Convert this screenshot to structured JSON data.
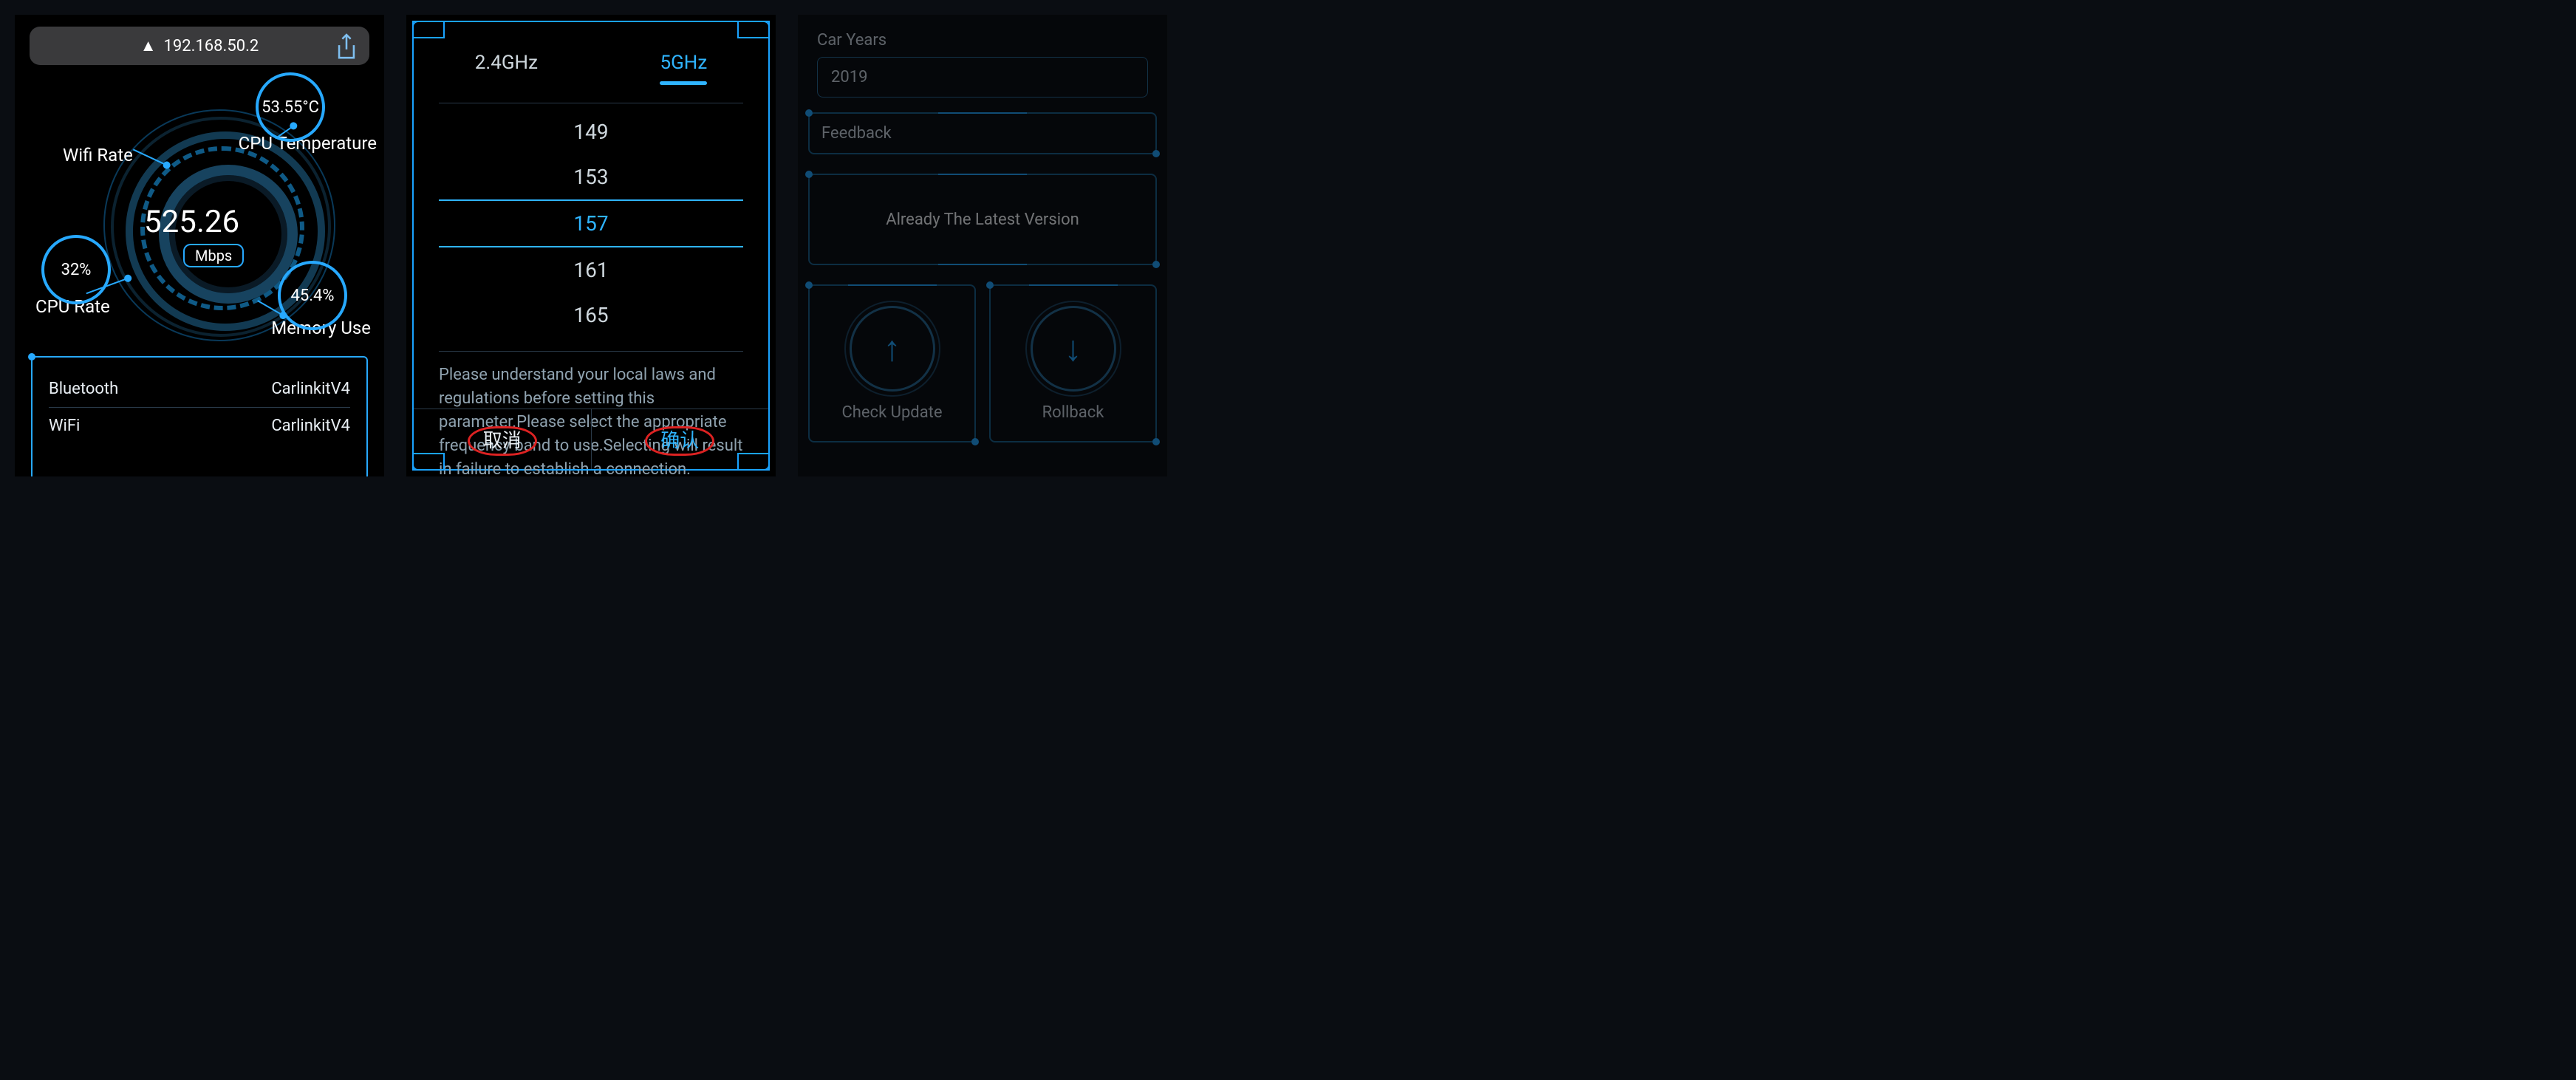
{
  "panel1": {
    "address": "192.168.50.2",
    "wifi_rate_label": "Wifi Rate",
    "wifi_rate_value": "525.26",
    "wifi_rate_unit": "Mbps",
    "cpu_rate_label": "CPU Rate",
    "cpu_rate_value": "32%",
    "cpu_temp_label": "CPU Temperature",
    "cpu_temp_value": "53.55°C",
    "mem_use_label": "Memory Use",
    "mem_use_value": "45.4%",
    "rows": {
      "bt_label": "Bluetooth",
      "bt_value": "CarlinkitV4",
      "wifi_label": "WiFi",
      "wifi_value": "CarlinkitV4"
    }
  },
  "panel2": {
    "tabs": {
      "t1": "2.4GHz",
      "t2": "5GHz"
    },
    "channels": {
      "c0": "149",
      "c1": "153",
      "c2": "157",
      "c3": "161",
      "c4": "165"
    },
    "selected_index": 2,
    "help_text": "Please understand your local laws and regulations before setting this parameter.Please select the appropriate frequency band to use.Selecting will result in failure to establish a connection.",
    "cancel": "取消",
    "confirm": "确认"
  },
  "panel3": {
    "car_years_label": "Car Years",
    "car_years_value": "2019",
    "feedback_label": "Feedback",
    "banner": "Already The Latest Version",
    "check_update": "Check Update",
    "rollback": "Rollback"
  }
}
